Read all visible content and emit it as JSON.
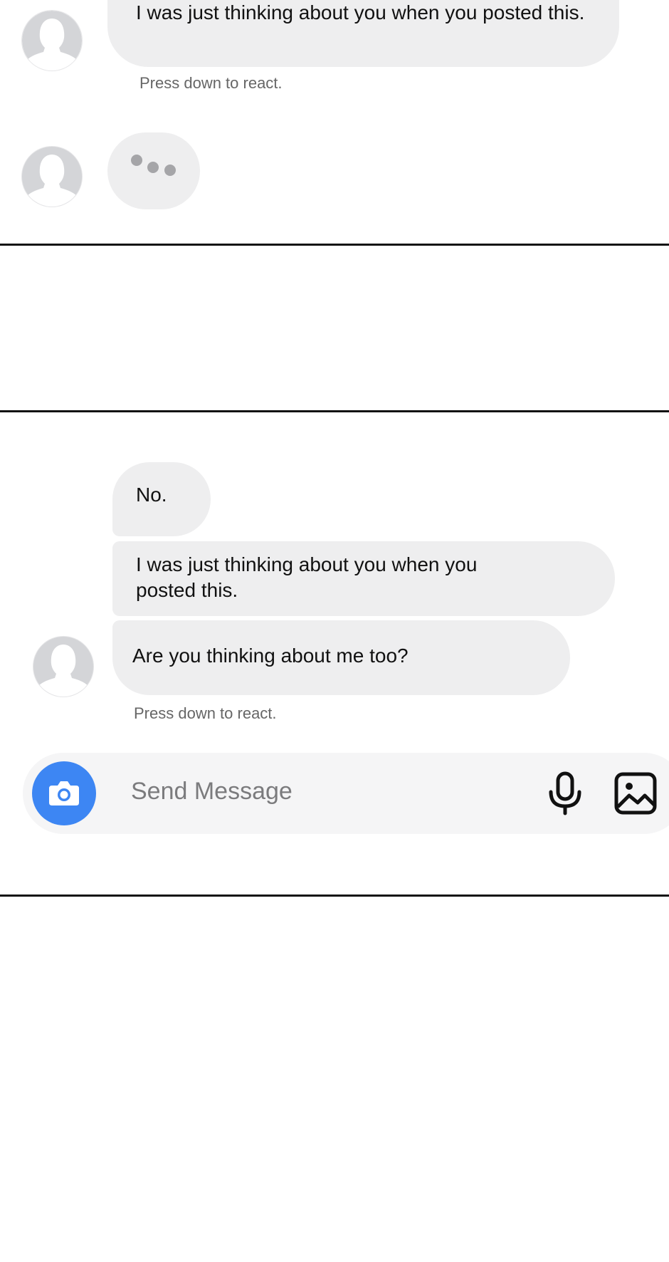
{
  "thread_top": {
    "partial_message": "I was just thinking about you when you posted this.",
    "react_hint": "Press down to react.",
    "typing_indicator_icon": "typing-dots-icon"
  },
  "thread_bottom": {
    "messages": [
      "No.",
      "I was just thinking about you when you posted this.",
      "Are you thinking about me too?"
    ],
    "react_hint": "Press down to react."
  },
  "composer": {
    "placeholder": "Send Message",
    "camera_icon": "camera-icon",
    "mic_icon": "microphone-icon",
    "gallery_icon": "image-icon",
    "accent_color": "#3d86f3"
  },
  "colors": {
    "bubble": "#eeeeef",
    "avatar": "#d4d5d8",
    "divider": "#111111"
  }
}
